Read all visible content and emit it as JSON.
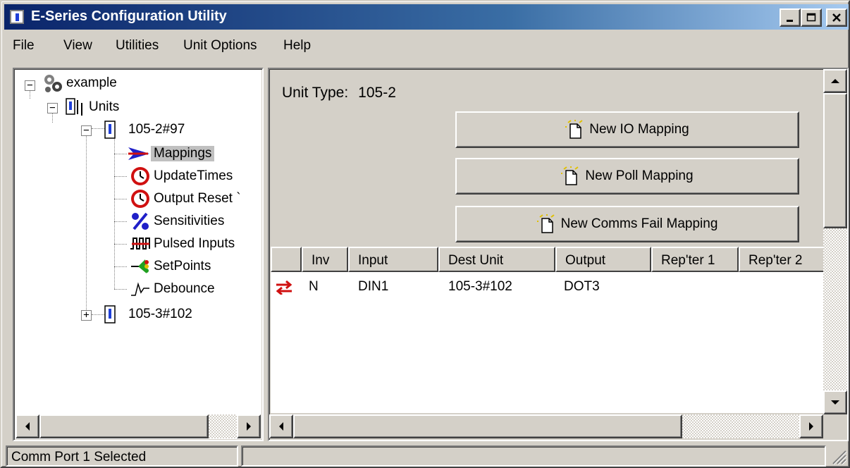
{
  "window": {
    "title": "E-Series Configuration Utility"
  },
  "menu": [
    {
      "label": "File"
    },
    {
      "label": "View"
    },
    {
      "label": "Utilities"
    },
    {
      "label": "Unit Options"
    },
    {
      "label": "Help"
    }
  ],
  "tree": {
    "root": {
      "label": "example",
      "icon": "gears-icon"
    },
    "units": {
      "label": "Units",
      "icon": "units-icon"
    },
    "unit1": {
      "label": "105-2#97",
      "icon": "unit-device-icon"
    },
    "children": [
      {
        "label": "Mappings",
        "icon": "arrow-icon",
        "selected": true
      },
      {
        "label": "UpdateTimes",
        "icon": "clock-icon"
      },
      {
        "label": "Output Reset `",
        "icon": "clock-icon"
      },
      {
        "label": "Sensitivities",
        "icon": "percent-icon"
      },
      {
        "label": "Pulsed Inputs",
        "icon": "pulse-icon"
      },
      {
        "label": "SetPoints",
        "icon": "setpoint-icon"
      },
      {
        "label": "Debounce",
        "icon": "debounce-icon"
      }
    ],
    "unit2": {
      "label": "105-3#102",
      "icon": "unit-device-icon"
    }
  },
  "main": {
    "unit_type_label": "Unit Type:",
    "unit_type_value": "105-2",
    "buttons": {
      "new_io": "New IO Mapping",
      "new_poll": "New Poll Mapping",
      "new_comms_fail": "New Comms Fail Mapping"
    },
    "table": {
      "headers": [
        "Inv",
        "Input",
        "Dest Unit",
        "Output",
        "Rep'ter 1",
        "Rep'ter 2"
      ],
      "rows": [
        {
          "icon": "bidirectional-arrows-icon",
          "inv": "N",
          "input": "DIN1",
          "dest_unit": "105-3#102",
          "output": "DOT3",
          "repeater1": "",
          "repeater2": ""
        }
      ]
    }
  },
  "status": {
    "text": "Comm Port 1 Selected",
    "secondary": ""
  },
  "colors": {
    "titlebar_start": "#0a246a",
    "titlebar_end": "#a6caf0",
    "face": "#d4d0c8",
    "selected": "#c0c0c0"
  }
}
